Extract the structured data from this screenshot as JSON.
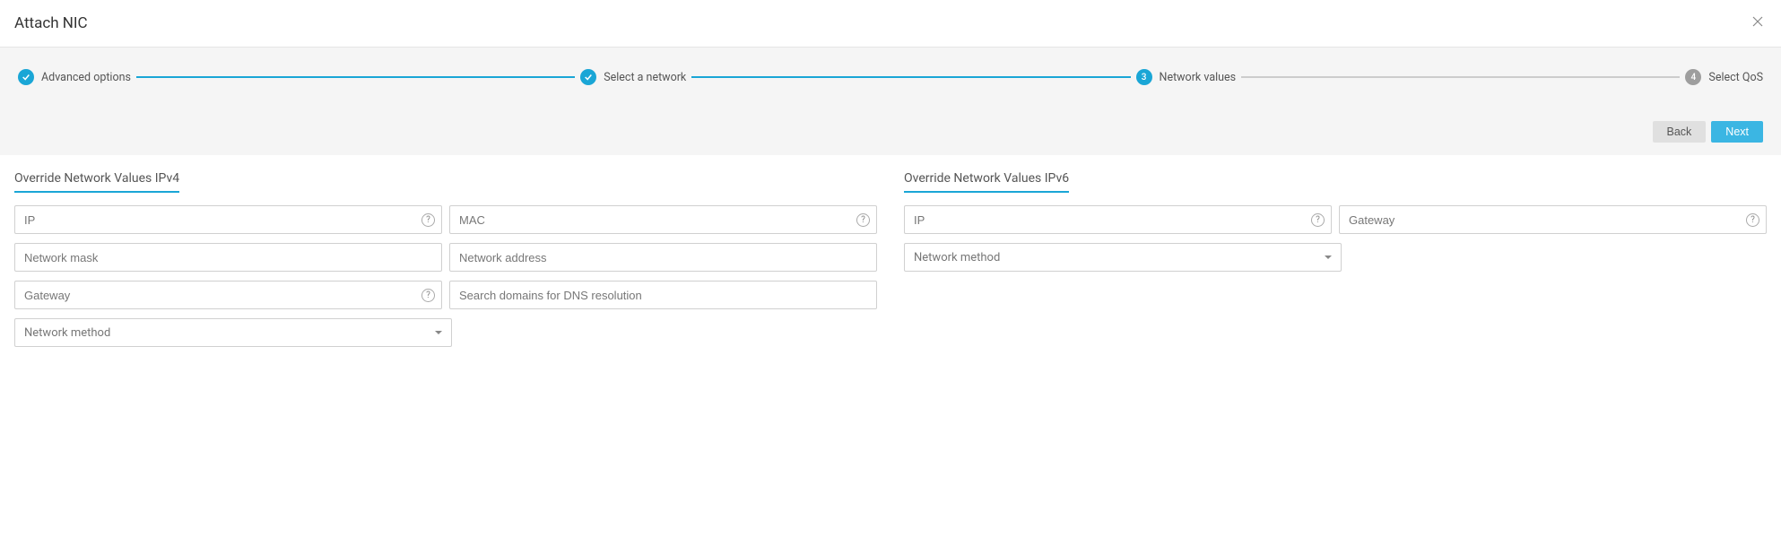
{
  "header": {
    "title": "Attach NIC"
  },
  "stepper": {
    "steps": [
      {
        "label": "Advanced options"
      },
      {
        "label": "Select a network"
      },
      {
        "label": "Network values",
        "num": "3"
      },
      {
        "label": "Select QoS",
        "num": "4"
      }
    ],
    "back_label": "Back",
    "next_label": "Next"
  },
  "ipv4": {
    "title": "Override Network Values IPv4",
    "ip_placeholder": "IP",
    "mac_placeholder": "MAC",
    "mask_placeholder": "Network mask",
    "netaddr_placeholder": "Network address",
    "gateway_placeholder": "Gateway",
    "dns_placeholder": "Search domains for DNS resolution",
    "method_label": "Network method"
  },
  "ipv6": {
    "title": "Override Network Values IPv6",
    "ip_placeholder": "IP",
    "gateway_placeholder": "Gateway",
    "method_label": "Network method"
  },
  "help_glyph": "?"
}
